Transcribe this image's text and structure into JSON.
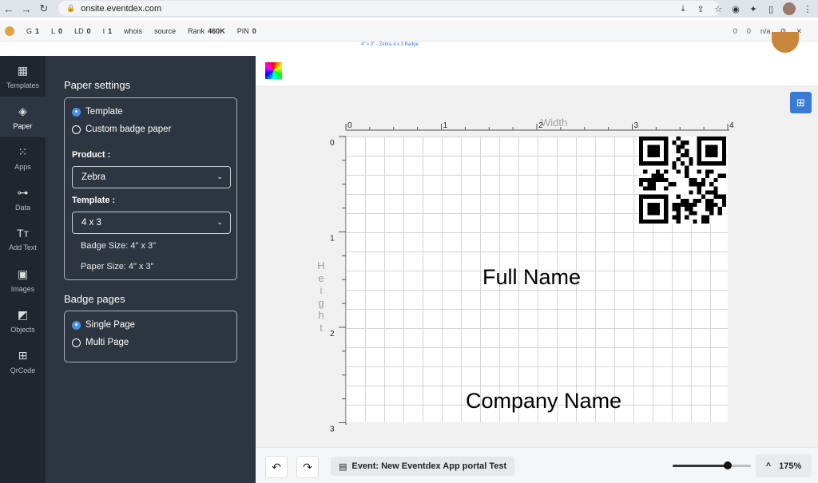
{
  "browser": {
    "url": "onsite.eventdex.com",
    "nav": {
      "back": "←",
      "forward": "→",
      "reload": "↻",
      "lock": "🔒"
    }
  },
  "seo_bar": {
    "items": [
      {
        "key": "G",
        "value": "1"
      },
      {
        "key": "L",
        "value": "0"
      },
      {
        "key": "LD",
        "value": "0"
      },
      {
        "key": "I",
        "value": "1"
      },
      {
        "key": "whois",
        "value": ""
      },
      {
        "key": "source",
        "value": ""
      },
      {
        "key": "Rank",
        "value": "460K"
      },
      {
        "key": "PIN",
        "value": "0"
      }
    ],
    "right": [
      {
        "key": "",
        "value": "0"
      },
      {
        "key": "",
        "value": "0"
      },
      {
        "key": "",
        "value": "n/a"
      }
    ]
  },
  "subtitle": "4\" x 3\" - Zebra 4 x 3 Badge",
  "rail": {
    "items": [
      {
        "label": "Templates",
        "icon": "▦"
      },
      {
        "label": "Paper",
        "icon": "◈"
      },
      {
        "label": "Apps",
        "icon": "⁙"
      },
      {
        "label": "Data",
        "icon": "⊶"
      },
      {
        "label": "Add Text",
        "icon": "Tт"
      },
      {
        "label": "Images",
        "icon": "▣"
      },
      {
        "label": "Objects",
        "icon": "◩"
      },
      {
        "label": "QrCode",
        "icon": "⊞"
      }
    ]
  },
  "panel": {
    "paper_settings_title": "Paper settings",
    "opt_template": "Template",
    "opt_custom": "Custom badge paper",
    "product_label": "Product :",
    "product_value": "Zebra",
    "template_label": "Template :",
    "template_value": "4 x 3",
    "badge_size": "Badge Size: 4\" x 3\"",
    "paper_size": "Paper Size: 4\" x 3\"",
    "badge_pages_title": "Badge pages",
    "opt_single": "Single Page",
    "opt_multi": "Multi Page"
  },
  "canvas": {
    "width_label": "Width",
    "height_label": [
      "H",
      "e",
      "i",
      "g",
      "h",
      "t"
    ],
    "x_ticks": [
      "0",
      "1",
      "2",
      "3",
      "4"
    ],
    "y_ticks": [
      "0",
      "1",
      "2",
      "3"
    ],
    "full_name": "Full Name",
    "company_name": "Company Name"
  },
  "bottom": {
    "undo_icon": "↶",
    "redo_icon": "↷",
    "event_icon": "▤",
    "event_label": "Event: New Eventdex App portal Test",
    "zoom_caret": "^",
    "zoom_value": "175%",
    "zoom_fraction": 0.7
  },
  "colors": {
    "accent": "#3a7bd5",
    "sidebar": "#1f262e",
    "panel": "#2d3640"
  }
}
